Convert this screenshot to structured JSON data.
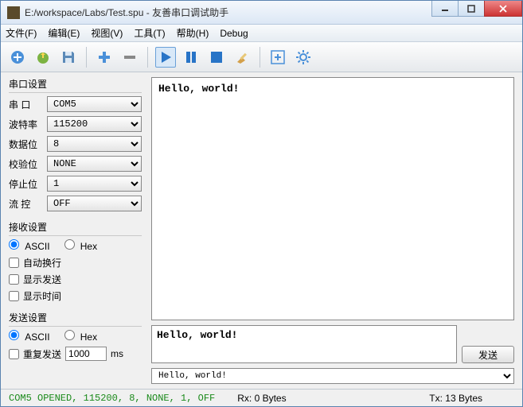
{
  "window": {
    "title": "E:/workspace/Labs/Test.spu - 友善串口调试助手"
  },
  "menu": {
    "file": "文件(F)",
    "edit": "编辑(E)",
    "view": "视图(V)",
    "tools": "工具(T)",
    "help": "帮助(H)",
    "debug": "Debug"
  },
  "serial": {
    "title": "串口设置",
    "port_label": "串  口",
    "port": "COM5",
    "baud_label": "波特率",
    "baud": "115200",
    "databits_label": "数据位",
    "databits": "8",
    "parity_label": "校验位",
    "parity": "NONE",
    "stopbits_label": "停止位",
    "stopbits": "1",
    "flow_label": "流  控",
    "flow": "OFF"
  },
  "recv": {
    "title": "接收设置",
    "ascii": "ASCII",
    "hex": "Hex",
    "autowrap": "自动换行",
    "showsend": "显示发送",
    "showtime": "显示时间"
  },
  "send": {
    "title": "发送设置",
    "ascii": "ASCII",
    "hex": "Hex",
    "repeat_label": "重复发送",
    "repeat_value": "1000",
    "repeat_unit": "ms"
  },
  "rx_text": "Hello, world!",
  "tx_text": "Hello, world!",
  "send_btn": "发送",
  "history": "Hello, world!",
  "status": {
    "conn": "COM5 OPENED, 115200, 8, NONE, 1, OFF",
    "rx": "Rx: 0 Bytes",
    "tx": "Tx: 13 Bytes"
  }
}
